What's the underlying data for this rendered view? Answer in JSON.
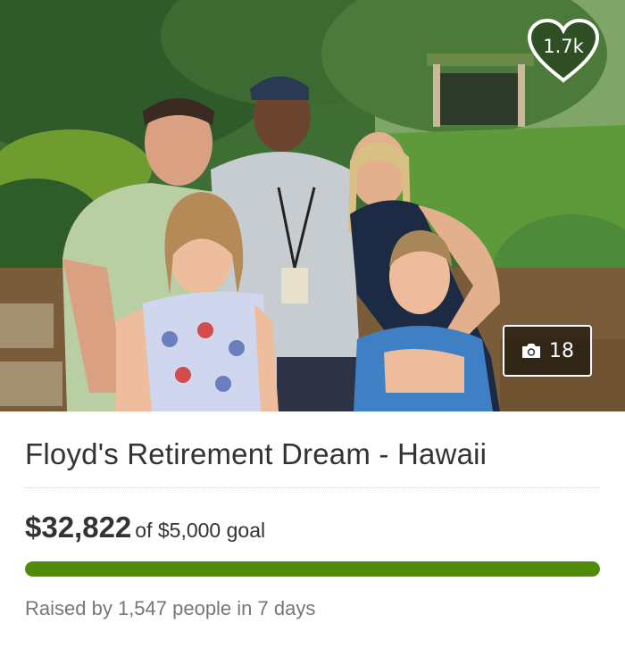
{
  "photo": {
    "likes_label": "1.7k",
    "photo_count": "18",
    "heart_icon": "heart-outline-icon",
    "camera_icon": "camera-icon"
  },
  "campaign": {
    "title": "Floyd's Retirement Dream - Hawaii",
    "amount_raised": "$32,822",
    "goal_text": "of $5,000 goal",
    "progress_fraction": 1.0,
    "raised_by": "Raised by 1,547 people in 7 days"
  },
  "colors": {
    "progress": "#4f8a0b",
    "text": "#333333",
    "muted": "#767676"
  }
}
